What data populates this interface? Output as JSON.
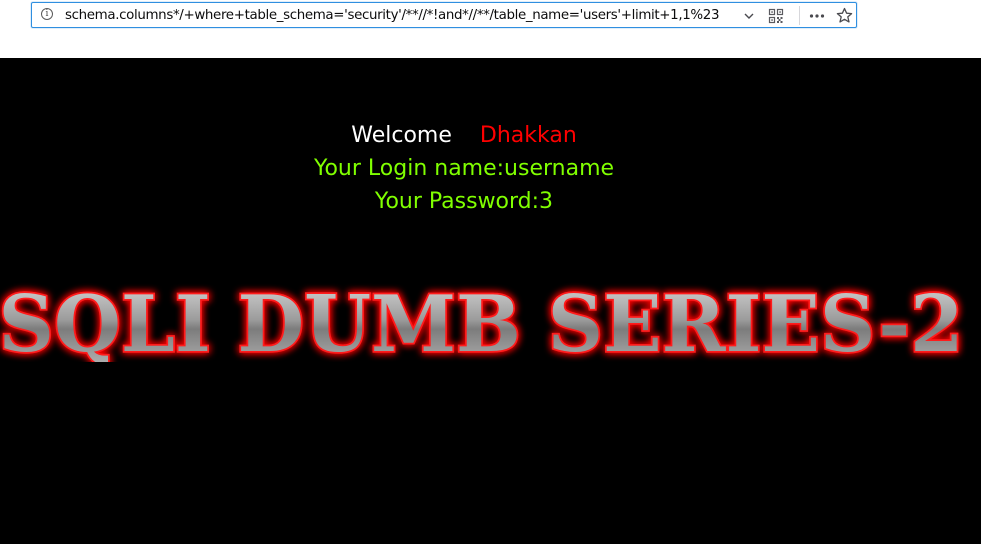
{
  "browser": {
    "url": "schema.columns*/+where+table_schema='security'/**//*!and*//**/table_name='users'+limit+1,1%23",
    "icons": {
      "info": "info-icon",
      "dropdown": "chevron-down-icon",
      "qr": "qr-code-icon",
      "more": "more-actions-icon",
      "bookmark": "star-icon"
    }
  },
  "page": {
    "welcome_label": "Welcome",
    "welcome_name": "Dhakkan",
    "login_line": "Your Login name:username",
    "password_line": "Your Password:3",
    "banner_title": "SQLI DUMB SERIES-2",
    "colors": {
      "background": "#000000",
      "welcome": "#ffffff",
      "name": "#ff0000",
      "result": "#80ff00",
      "banner_glow": "#ff0000",
      "banner_fill": "#9a9a9a"
    }
  }
}
